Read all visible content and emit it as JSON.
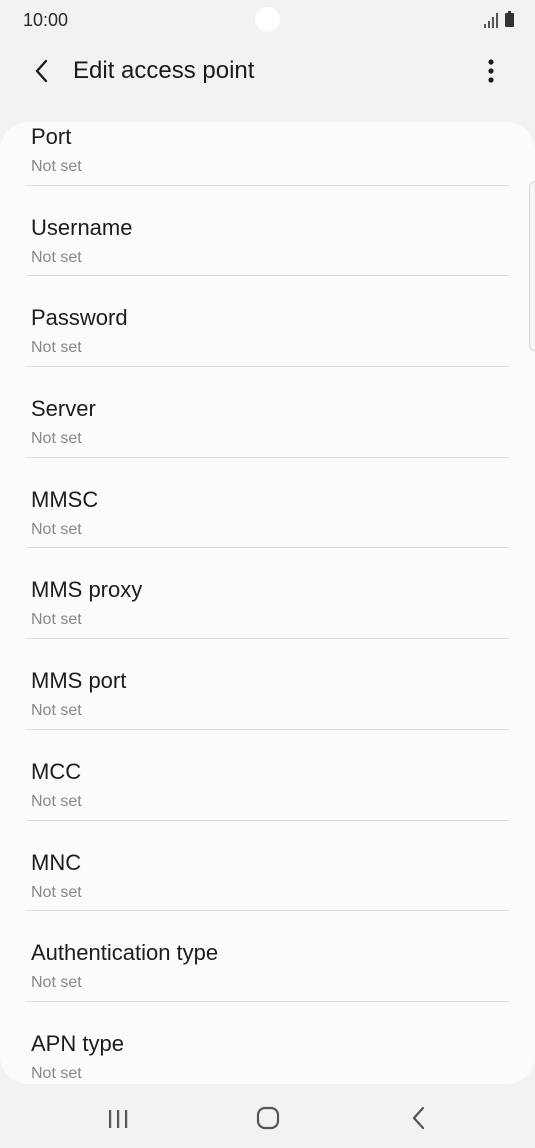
{
  "status_bar": {
    "time": "10:00",
    "icons": [
      "signal-icon",
      "battery-icon"
    ]
  },
  "header": {
    "title": "Edit access point",
    "back_icon": "chevron-left-icon",
    "menu_icon": "more-vertical-icon"
  },
  "settings": [
    {
      "title": "Port",
      "value": "Not set"
    },
    {
      "title": "Username",
      "value": "Not set"
    },
    {
      "title": "Password",
      "value": "Not set"
    },
    {
      "title": "Server",
      "value": "Not set"
    },
    {
      "title": "MMSC",
      "value": "Not set"
    },
    {
      "title": "MMS proxy",
      "value": "Not set"
    },
    {
      "title": "MMS port",
      "value": "Not set"
    },
    {
      "title": "MCC",
      "value": "Not set"
    },
    {
      "title": "MNC",
      "value": "Not set"
    },
    {
      "title": "Authentication type",
      "value": "Not set"
    },
    {
      "title": "APN type",
      "value": "Not set"
    }
  ],
  "nav_bar": {
    "icons": [
      "recents-icon",
      "home-icon",
      "back-icon"
    ]
  },
  "colors": {
    "background": "#f2f2f2",
    "card": "#fbfbfb",
    "title_text": "#1c1c1c",
    "secondary_text": "#888888",
    "divider": "#dcdcdc"
  }
}
